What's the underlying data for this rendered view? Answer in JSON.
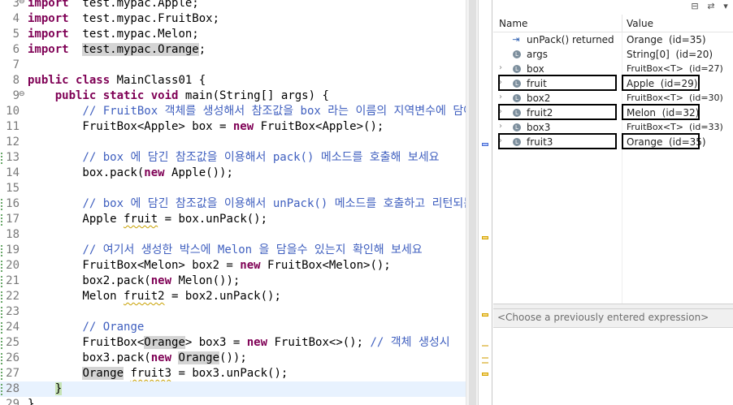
{
  "editor": {
    "lines": [
      {
        "num": "3",
        "fold": "⊖",
        "segs": [
          [
            "kw",
            "import"
          ],
          [
            "",
            "  test.mypac.Apple;"
          ]
        ]
      },
      {
        "num": "4",
        "segs": [
          [
            "kw",
            "import"
          ],
          [
            "",
            "  test.mypac.FruitBox;"
          ]
        ]
      },
      {
        "num": "5",
        "segs": [
          [
            "kw",
            "import"
          ],
          [
            "",
            "  test.mypac.Melon;"
          ]
        ]
      },
      {
        "num": "6",
        "segs": [
          [
            "kw",
            "import"
          ],
          [
            "",
            "  "
          ],
          [
            "hl",
            "test.mypac.Orange"
          ],
          [
            "",
            ";"
          ]
        ]
      },
      {
        "num": "7",
        "segs": []
      },
      {
        "num": "8",
        "segs": [
          [
            "kw",
            "public"
          ],
          [
            "",
            " "
          ],
          [
            "kw",
            "class"
          ],
          [
            "",
            " MainClass01 {"
          ]
        ]
      },
      {
        "num": "9",
        "fold": "⊖",
        "segs": [
          [
            "",
            "    "
          ],
          [
            "kw",
            "public"
          ],
          [
            "",
            " "
          ],
          [
            "kw",
            "static"
          ],
          [
            "",
            " "
          ],
          [
            "kw",
            "void"
          ],
          [
            "",
            " main(String[] args) {"
          ]
        ]
      },
      {
        "num": "10",
        "segs": [
          [
            "",
            "        "
          ],
          [
            "cm",
            "// FruitBox 객체를 생성해서 참조값을 box 라는 이름의 지역변수에 담아"
          ]
        ]
      },
      {
        "num": "11",
        "segs": [
          [
            "",
            "        FruitBox<Apple> box = "
          ],
          [
            "kw",
            "new"
          ],
          [
            "",
            " FruitBox<Apple>();"
          ]
        ]
      },
      {
        "num": "12",
        "segs": []
      },
      {
        "num": "13",
        "segs": [
          [
            "",
            "        "
          ],
          [
            "cm",
            "// box 에 담긴 참조값을 이용해서 pack() 메소드를 호출해 보세요"
          ]
        ]
      },
      {
        "num": "14",
        "segs": [
          [
            "",
            "        box.pack("
          ],
          [
            "kw",
            "new"
          ],
          [
            "",
            " Apple());"
          ]
        ]
      },
      {
        "num": "15",
        "segs": []
      },
      {
        "num": "16",
        "segs": [
          [
            "",
            "        "
          ],
          [
            "cm",
            "// box 에 담긴 참조값을 이용해서 unPack() 메소드를 호출하고 리턴되는"
          ]
        ]
      },
      {
        "num": "17",
        "segs": [
          [
            "",
            "        Apple "
          ],
          [
            "squig",
            "fruit"
          ],
          [
            "",
            " = box.unPack();"
          ]
        ]
      },
      {
        "num": "18",
        "segs": []
      },
      {
        "num": "19",
        "segs": [
          [
            "",
            "        "
          ],
          [
            "cm",
            "// 여기서 생성한 박스에 Melon 을 담을수 있는지 확인해 보세요"
          ]
        ]
      },
      {
        "num": "20",
        "segs": [
          [
            "",
            "        FruitBox<Melon> box2 = "
          ],
          [
            "kw",
            "new"
          ],
          [
            "",
            " FruitBox<Melon>();"
          ]
        ]
      },
      {
        "num": "21",
        "segs": [
          [
            "",
            "        box2.pack("
          ],
          [
            "kw",
            "new"
          ],
          [
            "",
            " Melon());"
          ]
        ]
      },
      {
        "num": "22",
        "segs": [
          [
            "",
            "        Melon "
          ],
          [
            "squig",
            "fruit2"
          ],
          [
            "",
            " = box2.unPack();"
          ]
        ]
      },
      {
        "num": "23",
        "segs": []
      },
      {
        "num": "24",
        "segs": [
          [
            "",
            "        "
          ],
          [
            "cm",
            "// Orange"
          ]
        ]
      },
      {
        "num": "25",
        "segs": [
          [
            "",
            "        FruitBox<"
          ],
          [
            "hl",
            "Orange"
          ],
          [
            "",
            "> box3 = "
          ],
          [
            "kw",
            "new"
          ],
          [
            "",
            " FruitBox<>(); "
          ],
          [
            "cm",
            "// 객체 생성시"
          ]
        ]
      },
      {
        "num": "26",
        "segs": [
          [
            "",
            "        box3.pack("
          ],
          [
            "kw",
            "new"
          ],
          [
            "",
            " "
          ],
          [
            "hl",
            "Orange"
          ],
          [
            "",
            "());"
          ]
        ]
      },
      {
        "num": "27",
        "segs": [
          [
            "",
            "        "
          ],
          [
            "hl",
            "Orange"
          ],
          [
            "",
            " "
          ],
          [
            "squig",
            "fruit3"
          ],
          [
            "",
            " = box3.unPack();"
          ]
        ]
      },
      {
        "num": "28",
        "current": true,
        "segs": [
          [
            "",
            "    "
          ],
          [
            "bracket",
            "}"
          ]
        ]
      },
      {
        "num": "29",
        "segs": [
          [
            "",
            "}"
          ]
        ]
      }
    ]
  },
  "variables": {
    "header": {
      "name": "Name",
      "value": "Value"
    },
    "rows": [
      {
        "twisty": "",
        "icon": "return",
        "name": "unPack() returned",
        "value": "Orange  (id=35)"
      },
      {
        "twisty": "",
        "icon": "local",
        "name": "args",
        "value": "String[0]  (id=20)"
      },
      {
        "twisty": "›",
        "icon": "local",
        "name": "box",
        "value": "FruitBox<T>  (id=27)",
        "small": true
      },
      {
        "twisty": "›",
        "icon": "local",
        "name": "fruit",
        "value": "Apple  (id=29)",
        "boxed": true
      },
      {
        "twisty": "›",
        "icon": "local",
        "name": "box2",
        "value": "FruitBox<T>  (id=30)",
        "small": true
      },
      {
        "twisty": "›",
        "icon": "local",
        "name": "fruit2",
        "value": "Melon  (id=32)",
        "boxed": true
      },
      {
        "twisty": "›",
        "icon": "local",
        "name": "box3",
        "value": "FruitBox<T>  (id=33)",
        "small": true
      },
      {
        "twisty": "›",
        "icon": "local",
        "name": "fruit3",
        "value": "Orange  (id=35)",
        "boxed": true
      }
    ],
    "expression_placeholder": "<Choose a previously entered expression>"
  },
  "icons": {
    "toolbar": [
      "collapse-all-icon",
      "show-type-names-icon",
      "view-menu-icon"
    ]
  }
}
